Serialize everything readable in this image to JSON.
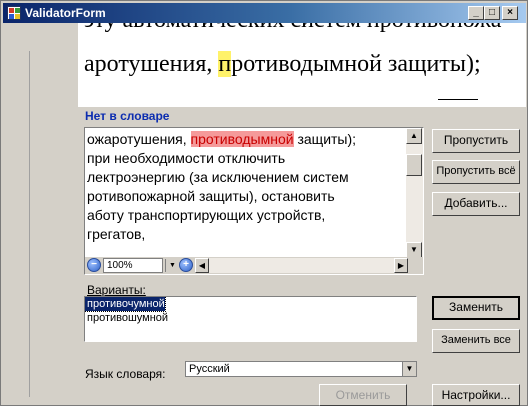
{
  "window": {
    "title": "ValidatorForm",
    "controls": {
      "minimize": "_",
      "maximize": "□",
      "close": "×"
    }
  },
  "preview": {
    "line_top": "эту автоматических систем противопожа",
    "line_main_before": "аротушения, ",
    "line_main_highlight": "п",
    "line_main_after": "ротиводымной защиты);"
  },
  "not_in_dictionary": {
    "label": "Нет в словаре",
    "lines": [
      {
        "before": "ожаротушения, ",
        "error": "противодымной",
        "after": " защиты);"
      },
      {
        "before": "     при необходимости отключить",
        "error": "",
        "after": ""
      },
      {
        "before": "лектроэнергию (за исключением систем",
        "error": "",
        "after": ""
      },
      {
        "before": "ротивопожарной защиты), остановить",
        "error": "",
        "after": ""
      },
      {
        "before": "аботу транспортирующих устройств,",
        "error": "",
        "after": ""
      },
      {
        "before": "грегатов,",
        "error": "",
        "after": ""
      }
    ],
    "zoom": "100%"
  },
  "buttons": {
    "skip": "Пропустить",
    "skip_all": "Пропустить всё",
    "add": "Добавить...",
    "replace": "Заменить",
    "replace_all": "Заменить все",
    "undo": "Отменить",
    "settings": "Настройки..."
  },
  "variants": {
    "label": "Варианты:",
    "items": [
      "противочумной",
      "противошумной"
    ],
    "selected_index": 0
  },
  "language": {
    "label": "Язык словаря:",
    "value": "Русский"
  }
}
